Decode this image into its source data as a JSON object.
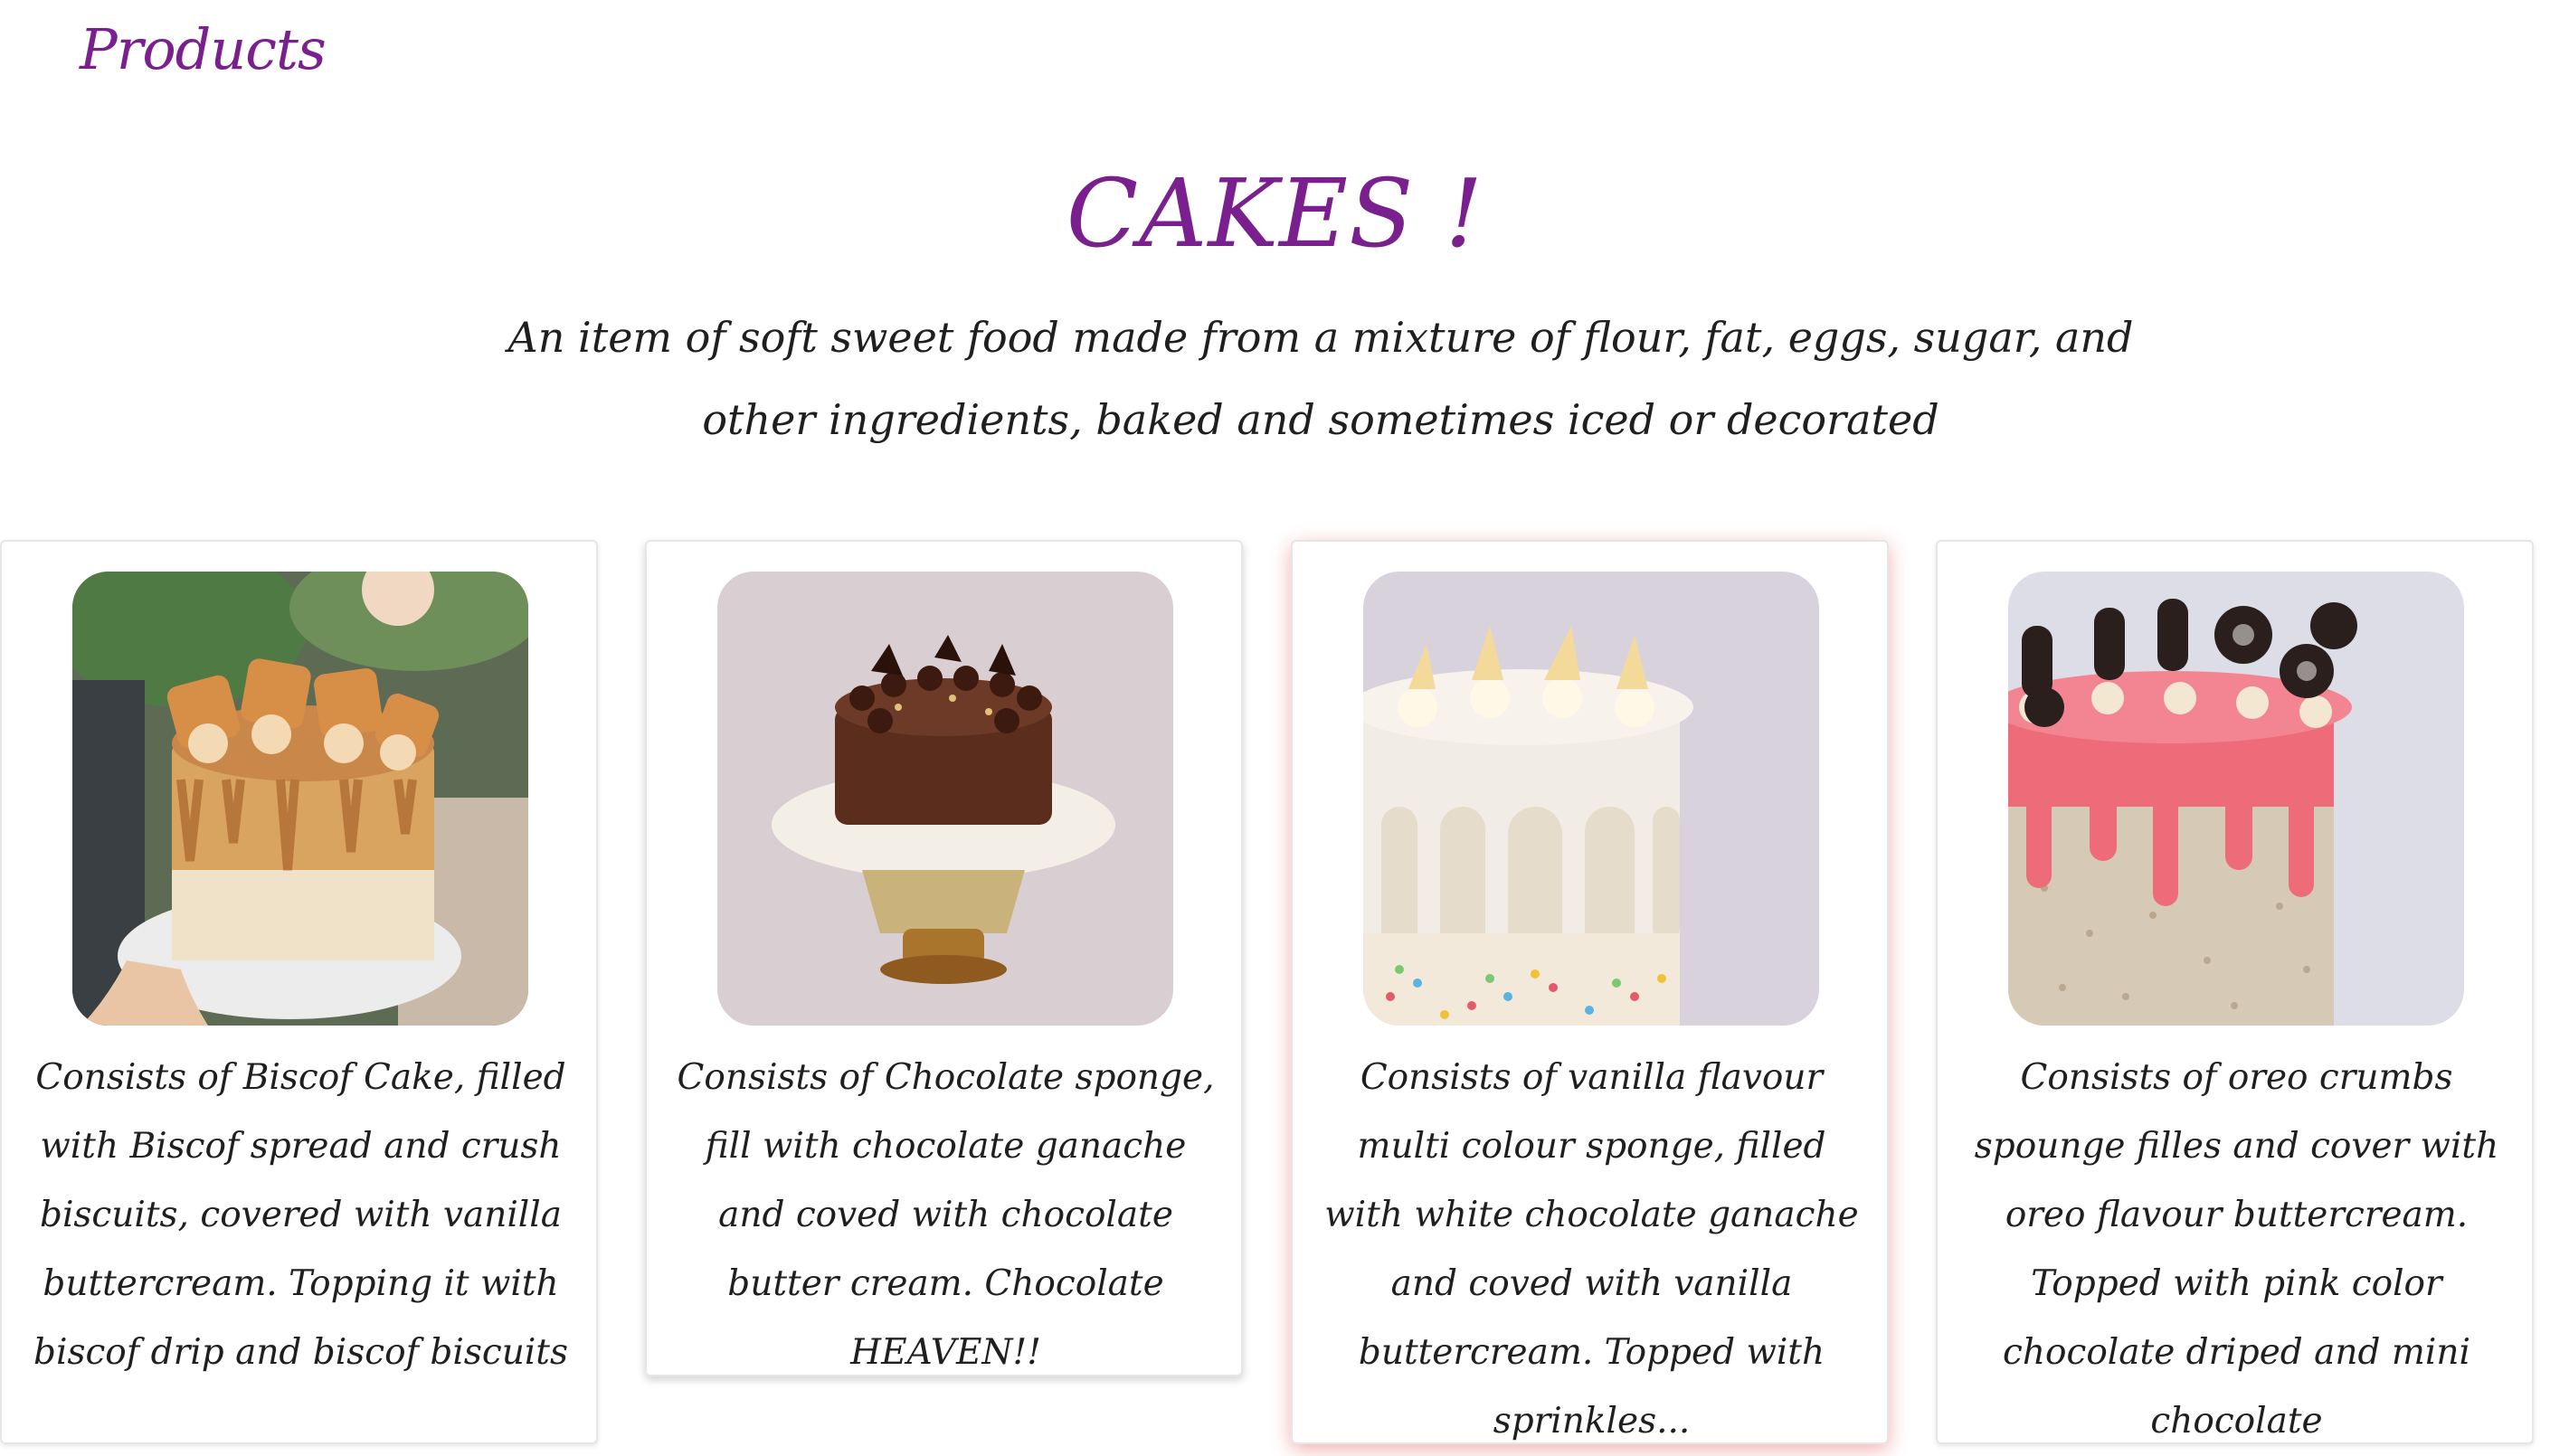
{
  "nav": {
    "title": "Products"
  },
  "hero": {
    "title": "CAKES !",
    "description": "An item of soft sweet food made from a mixture of flour, fat, eggs, sugar, and other ingredients, baked and sometimes iced or decorated"
  },
  "colors": {
    "brand": "#7a1f8e",
    "text": "#1f1f1f",
    "hover_glow": "#e25050"
  },
  "products": [
    {
      "image": "biscof-cake-image",
      "description": "Consists of Biscof Cake, filled with Biscof spread and crush biscuits, covered with vanilla buttercream. Topping it with biscof drip and biscof biscuits"
    },
    {
      "image": "chocolate-cake-image",
      "description": "Consists of Chocolate sponge, fill with chocolate ganache and coved with chocolate butter cream. Chocolate HEAVEN!!"
    },
    {
      "image": "vanilla-sprinkle-cake-image",
      "description": "Consists of vanilla flavour multi colour sponge, filled with white chocolate ganache and coved with vanilla buttercream. Topped with sprinkles..."
    },
    {
      "image": "oreo-cake-image",
      "description": "Consists of oreo crumbs spounge filles and cover with oreo flavour buttercream. Topped with pink color chocolate driped and mini chocolate"
    }
  ]
}
